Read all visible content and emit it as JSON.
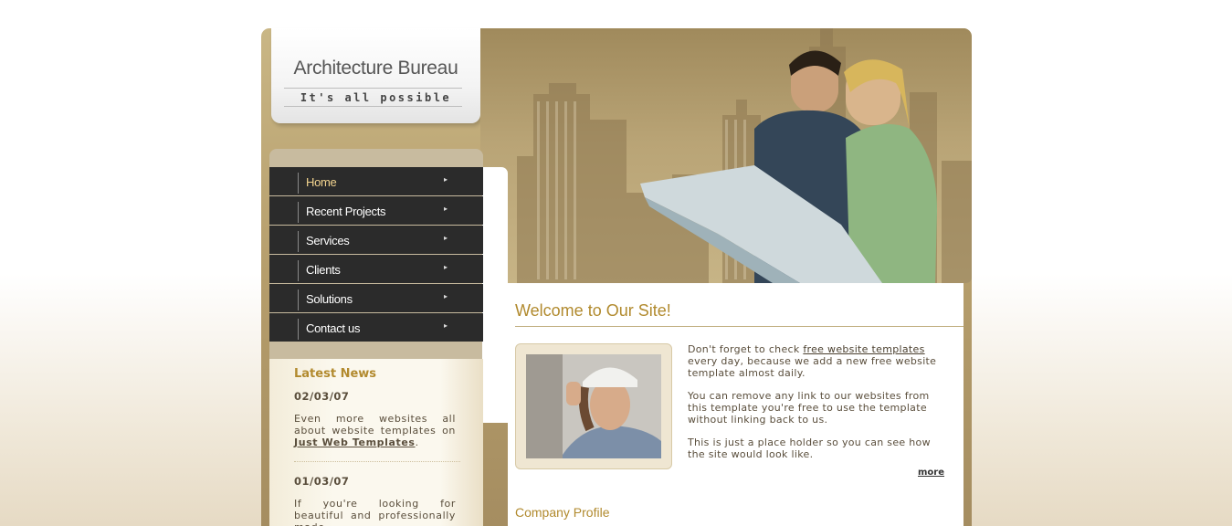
{
  "logo": {
    "title": "Architecture Bureau",
    "slogan": "It's all possible"
  },
  "nav": {
    "items": [
      {
        "label": "Home",
        "active": true
      },
      {
        "label": "Recent Projects"
      },
      {
        "label": "Services"
      },
      {
        "label": "Clients"
      },
      {
        "label": "Solutions"
      },
      {
        "label": "Contact us"
      }
    ],
    "arrow_icon": "arrow-right-icon"
  },
  "news": {
    "title": "Latest News",
    "items": [
      {
        "date": "02/03/07",
        "text": "Even more websites all about website templates on ",
        "link": "Just Web Templates",
        "after": "."
      },
      {
        "date": "01/03/07",
        "text": "If you're looking for beautiful and professionally made"
      }
    ]
  },
  "content": {
    "title": "Welcome to Our Site!",
    "p1_before": "Don't forget to check ",
    "p1_link": "free website templates",
    "p1_after": " every day, because we add a new free website template almost daily.",
    "p2": "You can remove any link to our websites from this template you're free to use the template without linking back to us.",
    "p3": "This is just a place holder so you can see how the site would look like.",
    "more": "more",
    "section2": "Company Profile"
  },
  "colors": {
    "accent": "#b18a2e",
    "nav_bg": "#2b2b2b",
    "frame": "#b59d6b"
  }
}
